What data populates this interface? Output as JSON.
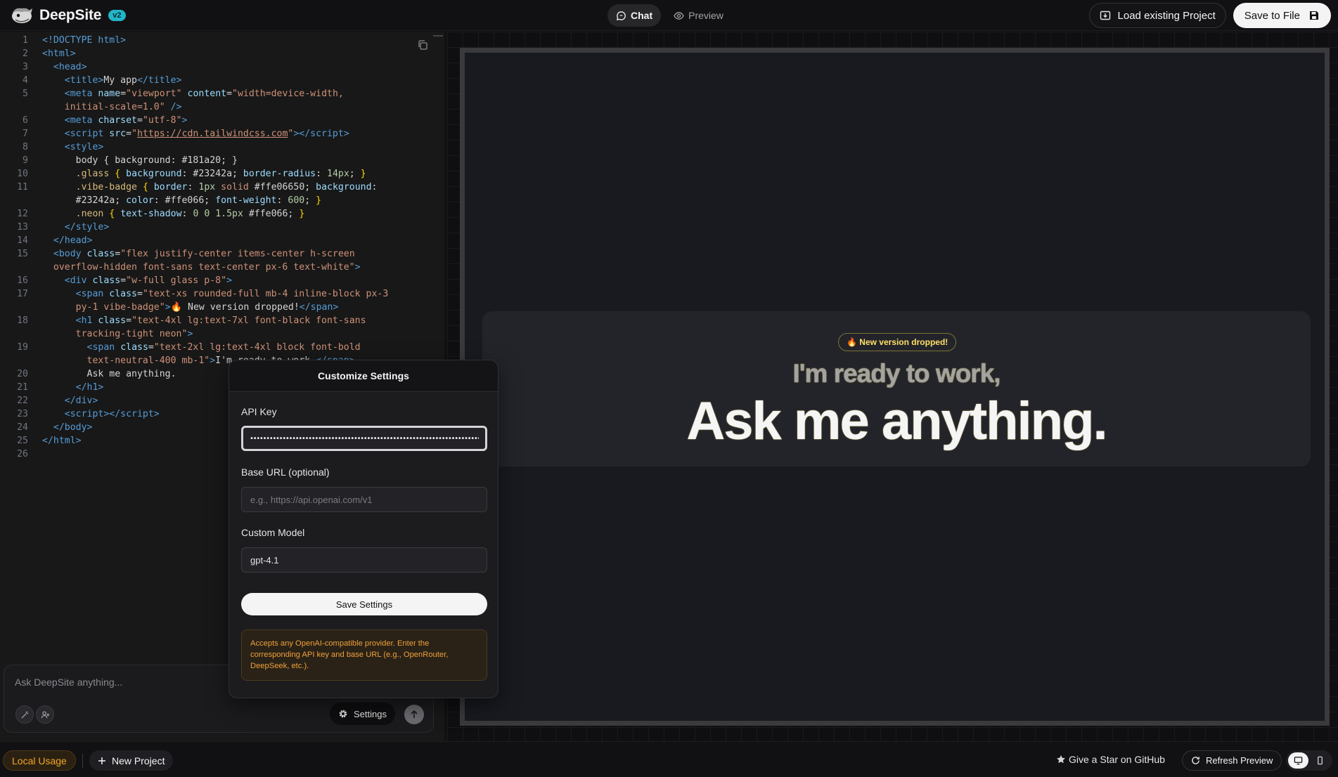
{
  "header": {
    "app_name": "DeepSite",
    "version_badge": "v2",
    "tabs": [
      {
        "label": "Chat",
        "icon": "chat-bubble-icon",
        "active": true
      },
      {
        "label": "Preview",
        "icon": "eye-icon",
        "active": false
      }
    ],
    "load_project_label": "Load existing Project",
    "save_file_label": "Save to File"
  },
  "editor": {
    "lines": [
      {
        "n": "1"
      },
      {
        "n": "2"
      },
      {
        "n": "3"
      },
      {
        "n": "4"
      },
      {
        "n": "5"
      },
      {
        "n": ""
      },
      {
        "n": "6"
      },
      {
        "n": "7"
      },
      {
        "n": "8"
      },
      {
        "n": "9"
      },
      {
        "n": "10"
      },
      {
        "n": "11"
      },
      {
        "n": ""
      },
      {
        "n": "12"
      },
      {
        "n": "13"
      },
      {
        "n": "14"
      },
      {
        "n": "15"
      },
      {
        "n": ""
      },
      {
        "n": "16"
      },
      {
        "n": "17"
      },
      {
        "n": ""
      },
      {
        "n": "18"
      },
      {
        "n": ""
      },
      {
        "n": "19"
      },
      {
        "n": ""
      },
      {
        "n": "20"
      },
      {
        "n": "21"
      },
      {
        "n": "22"
      },
      {
        "n": "23"
      },
      {
        "n": "24"
      },
      {
        "n": "25"
      },
      {
        "n": "26"
      }
    ],
    "code": {
      "l1": "<!DOCTYPE html>",
      "l2": "<html>",
      "l3": "  <head>",
      "l4_title": "My app",
      "l5_content_a": "\"width=device-width,",
      "l5_content_b": "initial-scale=1.0\"",
      "l6_charset": "\"utf-8\"",
      "l7_src": "https://cdn.tailwindcss.com",
      "l9": "body { background: #181a20; }",
      "l10_sel": ".glass",
      "l11_sel": ".vibe-badge",
      "l12_sel": ".neon",
      "l15_class_a": "\"flex justify-center items-center h-screen",
      "l15_class_b": "overflow-hidden font-sans text-center px-6 text-white\"",
      "l16_class": "\"w-full glass p-8\"",
      "l17_class_a": "\"text-xs rounded-full mb-4 inline-block px-3",
      "l17_class_b": "py-1 vibe-badge\"",
      "l17_text": "🔥 New version dropped!",
      "l18_class_a": "\"text-4xl lg:text-7xl font-black font-sans",
      "l18_class_b": "tracking-tight neon\"",
      "l19_class_a": "\"text-2xl lg:text-4xl block font-bold",
      "l19_class_b": "text-neutral-400 mb-1\"",
      "l19_text": "I'm ready to work,",
      "l20_text": "Ask me anything."
    }
  },
  "chat": {
    "placeholder": "Ask DeepSite anything...",
    "settings_label": "Settings"
  },
  "settings_popover": {
    "title": "Customize Settings",
    "api_key_label": "API Key",
    "api_key_value": "••••••••••••••••••••••••••••••••••••••••••••••••••••••••••••••••••••••••••",
    "base_url_label": "Base URL (optional)",
    "base_url_placeholder": "e.g., https://api.openai.com/v1",
    "model_label": "Custom Model",
    "model_value": "gpt-4.1",
    "save_label": "Save Settings",
    "note": "Accepts any OpenAI-compatible provider. Enter the corresponding API key and base URL (e.g., OpenRouter, DeepSeek, etc.)."
  },
  "preview": {
    "badge": "🔥 New version dropped!",
    "subtitle": "I'm ready to work,",
    "headline": "Ask me anything."
  },
  "footer": {
    "local_usage": "Local Usage",
    "new_project": "New Project",
    "github": "Give a Star on GitHub",
    "refresh": "Refresh Preview"
  },
  "colors": {
    "accent_badge": "#22b5c7",
    "preview_bg": "#181a20",
    "glass_bg": "#23242a",
    "neon_yellow": "#ffe066",
    "warning_text": "#f0a13b"
  }
}
